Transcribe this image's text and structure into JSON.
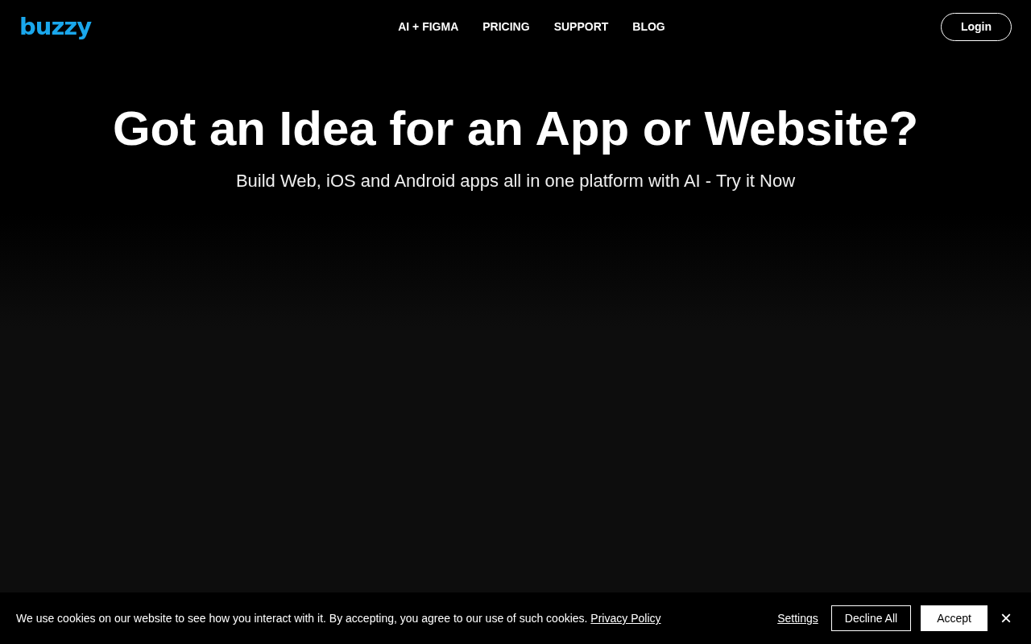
{
  "header": {
    "logo": "buzzy",
    "nav": [
      {
        "label": "AI + FIGMA"
      },
      {
        "label": "PRICING"
      },
      {
        "label": "SUPPORT"
      },
      {
        "label": "BLOG"
      }
    ],
    "login": "Login"
  },
  "hero": {
    "title": "Got an Idea for an App or Website?",
    "subtitle": "Build Web, iOS and Android apps all in one platform with AI - Try it Now"
  },
  "cookie_bar": {
    "message": "We use cookies on our website to see how you interact with it. By accepting, you agree to our use of such cookies.",
    "link": "Privacy Policy",
    "settings": "Settings",
    "decline": "Decline All",
    "accept": "Accept",
    "close": "×"
  }
}
